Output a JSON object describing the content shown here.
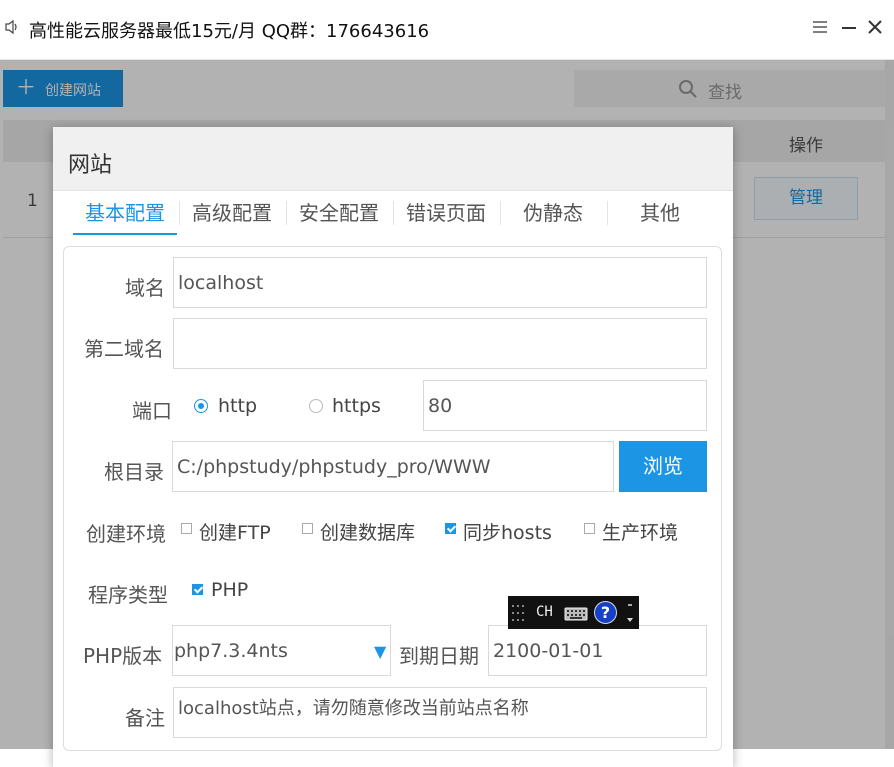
{
  "window": {
    "title": "高性能云服务器最低15元/月  QQ群：176643616"
  },
  "toolbar": {
    "create_label": "创建网站",
    "search_label": "查找"
  },
  "table": {
    "op_header": "操作",
    "rows": [
      {
        "index": "1",
        "action": "管理"
      }
    ]
  },
  "modal": {
    "title": "网站",
    "tabs": [
      "基本配置",
      "高级配置",
      "安全配置",
      "错误页面",
      "伪静态",
      "其他"
    ],
    "active_tab": "基本配置",
    "form": {
      "domain_label": "域名",
      "domain_value": "localhost",
      "second_domain_label": "第二域名",
      "second_domain_value": "",
      "port_label": "端口",
      "http_label": "http",
      "https_label": "https",
      "protocol_selected": "http",
      "port_value": "80",
      "root_label": "根目录",
      "root_value": "C:/phpstudy/phpstudy_pro/WWW",
      "browse_label": "浏览",
      "env_label": "创建环境",
      "env_options": [
        {
          "label": "创建FTP",
          "checked": false
        },
        {
          "label": "创建数据库",
          "checked": false
        },
        {
          "label": "同步hosts",
          "checked": true
        },
        {
          "label": "生产环境",
          "checked": false
        }
      ],
      "program_label": "程序类型",
      "program_options": [
        {
          "label": "PHP",
          "checked": true
        }
      ],
      "php_version_label": "PHP版本",
      "php_version_value": "php7.3.4nts",
      "expire_label": "到期日期",
      "expire_value": "2100-01-01",
      "remark_label": "备注",
      "remark_value": "localhost站点，请勿随意修改当前站点名称"
    }
  },
  "ime": {
    "mode": "CH",
    "help": "?"
  },
  "colors": {
    "accent": "#1c95e5",
    "overlay": "rgba(0,0,0,0.30)"
  }
}
